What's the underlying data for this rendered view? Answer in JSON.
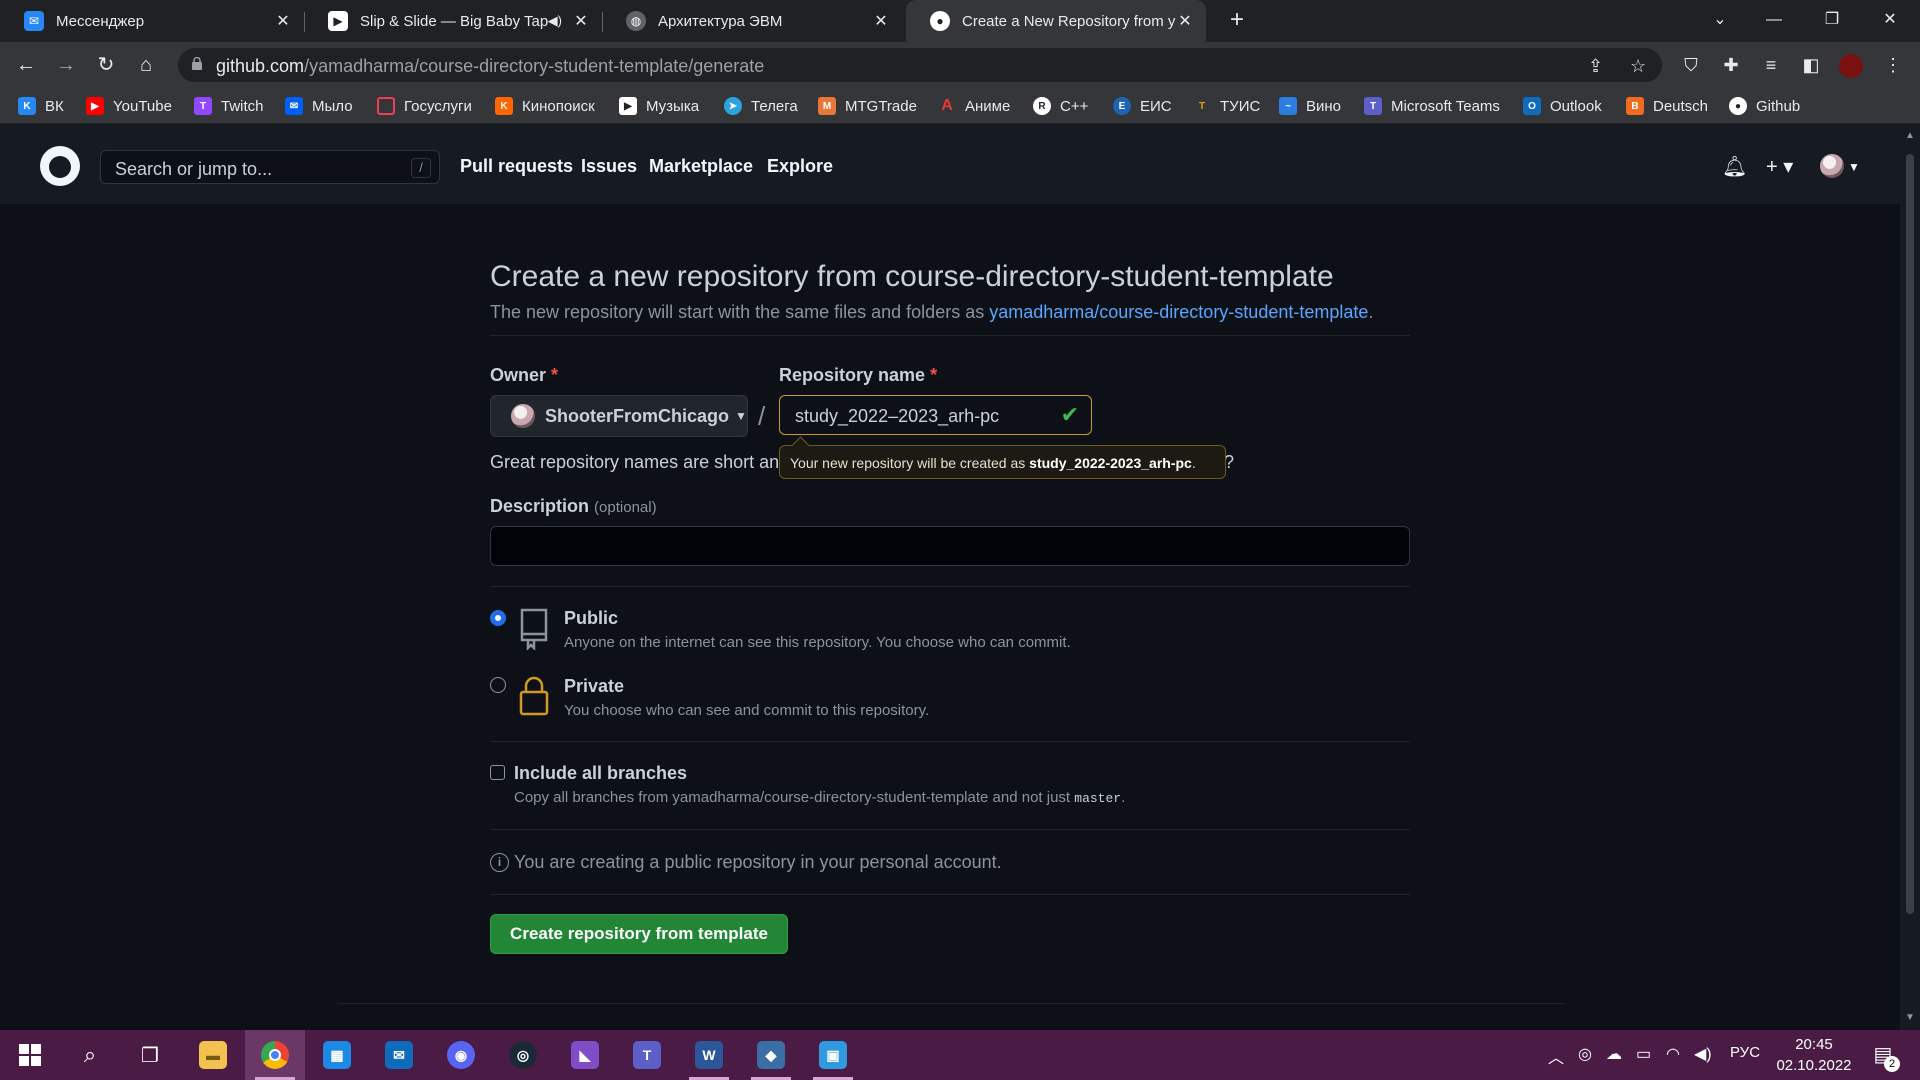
{
  "browser": {
    "tabs": [
      {
        "title": "Мессенджер",
        "icon": "vk-messenger-icon",
        "color": "#2787f5"
      },
      {
        "title": "Slip & Slide — Big Baby Tape",
        "icon": "youtube-music-icon",
        "color": "#ffffff"
      },
      {
        "title": "Архитектура ЭВМ",
        "icon": "globe-icon",
        "color": "#9aa0a6"
      },
      {
        "title": "Create a New Repository from yamadharma",
        "icon": "github-icon",
        "color": "#ffffff"
      }
    ],
    "url_host": "github.com",
    "url_path": "/yamadharma/course-directory-student-template/generate"
  },
  "bookmarks": [
    {
      "label": "ВК",
      "color": "#2787f5",
      "glyph": "K"
    },
    {
      "label": "YouTube",
      "color": "#ff0000",
      "glyph": "▶"
    },
    {
      "label": "Twitch",
      "color": "#9146ff",
      "glyph": "T"
    },
    {
      "label": "Мыло",
      "color": "#005ff9",
      "glyph": "✉"
    },
    {
      "label": "Госуслуги",
      "color": "#ee3f58",
      "glyph": "□"
    },
    {
      "label": "Кинопоиск",
      "color": "#ff6600",
      "glyph": "K"
    },
    {
      "label": "Музыка",
      "color": "#ffffff",
      "glyph": "▶"
    },
    {
      "label": "Телега",
      "color": "#2aa3df",
      "glyph": "➤"
    },
    {
      "label": "MTGTrade",
      "color": "#e8773a",
      "glyph": "M"
    },
    {
      "label": "Аниме",
      "color": "#e53935",
      "glyph": "A"
    },
    {
      "label": "C++",
      "color": "#ffffff",
      "glyph": "R"
    },
    {
      "label": "ЕИС",
      "color": "#1e63b4",
      "glyph": "Е"
    },
    {
      "label": "ТУИС",
      "color": "#f39c12",
      "glyph": "Т"
    },
    {
      "label": "Вино",
      "color": "#2a7de1",
      "glyph": "~"
    },
    {
      "label": "Microsoft Teams",
      "color": "#5b5fc7",
      "glyph": "T"
    },
    {
      "label": "Outlook",
      "color": "#0f6cbd",
      "glyph": "O"
    },
    {
      "label": "Deutsch",
      "color": "#f26b21",
      "glyph": "B"
    },
    {
      "label": "Github",
      "color": "#ffffff",
      "glyph": "●"
    }
  ],
  "github": {
    "search_placeholder": "Search or jump to...",
    "search_shortcut": "/",
    "nav": [
      "Pull requests",
      "Issues",
      "Marketplace",
      "Explore"
    ]
  },
  "form": {
    "title": "Create a new repository from course-directory-student-template",
    "subtitle_prefix": "The new repository will start with the same files and folders as ",
    "template_link": "yamadharma/course-directory-student-template",
    "subtitle_suffix": ".",
    "owner_label": "Owner",
    "required_mark": "*",
    "owner_value": "ShooterFromChicago",
    "slash": "/",
    "repo_label": "Repository name",
    "repo_value": "study_2022–2023_arh-pc",
    "hint_text": "Great repository names are short and",
    "hint_tail": "?",
    "tooltip_prefix": "Your new repository will be created as ",
    "tooltip_name": "study_2022-2023_arh-pc",
    "tooltip_suffix": ".",
    "description_label": "Description",
    "description_optional": "(optional)",
    "description_value": "",
    "public_title": "Public",
    "public_note": "Anyone on the internet can see this repository. You choose who can commit.",
    "private_title": "Private",
    "private_note": "You choose who can see and commit to this repository.",
    "branches_title": "Include all branches",
    "branches_note_prefix": "Copy all branches from yamadharma/course-directory-student-template and not just ",
    "branches_note_code": "master",
    "branches_note_suffix": ".",
    "notice": "You are creating a public repository in your personal account.",
    "create_button": "Create repository from template",
    "visibility_selected": "Public",
    "include_all_branches": false
  },
  "taskbar": {
    "apps": [
      {
        "name": "file-explorer",
        "glyph": "▬",
        "color": "#f2c14e"
      },
      {
        "name": "chrome",
        "glyph": "●",
        "color": "#4285f4"
      },
      {
        "name": "calculator-app",
        "glyph": "▦",
        "color": "#1e88e5"
      },
      {
        "name": "mail",
        "glyph": "✉",
        "color": "#0f6cbd"
      },
      {
        "name": "discord",
        "glyph": "◉",
        "color": "#5865f2"
      },
      {
        "name": "steam",
        "glyph": "◎",
        "color": "#1b2838"
      },
      {
        "name": "visual-studio",
        "glyph": "◣",
        "color": "#7f4ec6"
      },
      {
        "name": "teams",
        "glyph": "T",
        "color": "#5b5fc7"
      },
      {
        "name": "word",
        "glyph": "W",
        "color": "#2b579a"
      },
      {
        "name": "virtualbox",
        "glyph": "◆",
        "color": "#3a6ea5"
      },
      {
        "name": "remote-desktop",
        "glyph": "▣",
        "color": "#2f9ae0"
      }
    ],
    "lang": "РУС",
    "time": "20:45",
    "date": "02.10.2022",
    "notifications": "2"
  }
}
